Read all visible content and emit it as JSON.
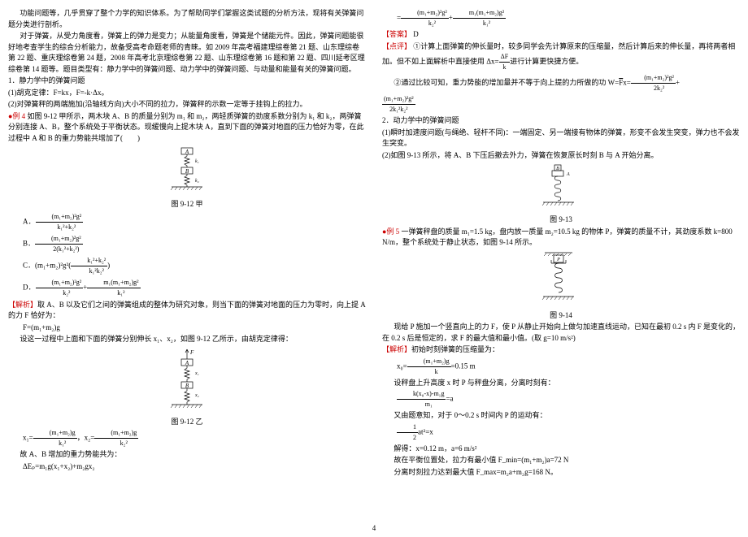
{
  "c1": {
    "p1": "功能问题等，几乎贯穿了整个力学的知识体系。为了帮助同学们掌握这类试题的分析方法，现将有关弹簧问题分类进行剖析。",
    "p2": "对于弹簧，从受力角度看，弹簧上的弹力是变力；从能量角度看，弹簧是个储能元件。因此，弹簧问题能很好地考查学生的综合分析能力，故备受高考命题老师的青睐。如 2009 年高考福建理综卷第 21 题、山东理综卷第 22 题、重庆理综卷第 24 题，2008 年高考北京理综卷第 22 题、山东理综卷第 16 题和第 22 题、四川延考区理综卷第 14 题等。题目类型有：静力学中的弹簧问题、动力学中的弹簧问题、与动量和能量有关的弹簧问题。",
    "s1": "1．静力学中的弹簧问题",
    "s1a": "(1)胡克定律：F=kx，F=-k·Δx。",
    "s1b": "(2)对弹簧秤的两端施加(沿轴线方向)大小不同的拉力，弹簧秤的示数一定等于挂钩上的拉力。",
    "ex4_lead": "●例 4",
    "ex4": "  如图 9-12 甲所示，两木块 A、B 的质量分别为 m₁ 和 m₂，两轻质弹簧的劲度系数分别为 k₁ 和 k₂，两弹簧分别连接 A、B，整个系统处于平衡状态。现缓慢向上提木块 A，直到下面的弹簧对地面的压力恰好为零，在此过程中 A 和 B 的重力势能共增加了(　　)",
    "cap1": "图 9-12 甲",
    "optA": "A．",
    "optB": "B．",
    "optC": "C．",
    "optD": "D．",
    "ans_h": "【解析】",
    "ans_t": "取 A、B 以及它们之间的弹簧组成的整体为研究对象，则当下面的弹簧对地面的压力为零时，向上提 A 的力 F 恰好为：",
    "f1": "F=(m₁+m₂)g",
    "ans_t2": "设这一过程中上面和下面的弹簧分别伸长 x₁、x₂，如图 9-12 乙所示，由胡克定律得：",
    "cap2": "图 9-12 乙",
    "f2x": "x₁=",
    "comma": "，",
    "f2y": "x₂=",
    "ep1": "故 A、B 增加的重力势能共为：",
    "ep2": "ΔEₚ=m₁g(x₁+x₂)+m₂gx₂"
  },
  "c2": {
    "f3_eq": "=",
    "f3_plus": "+",
    "ans_label": "【答案】",
    "ans": "  D",
    "note_h": "【点评】",
    "note": " ①计算上面弹簧的伸长量时，较多同学会先计算原来的压缩量，然后计算后来的伸长量，再将两者相加。但不如上面解析中直接使用 Δx=",
    "note2": "进行计算更快捷方便。",
    "note3": "②通过比较可知，重力势能的增加量并不等于向上提的力所做的功 W=",
    "note3b": "x=",
    "s2": "2．动力学中的弹簧问题",
    "s2a": "(1)瞬时加速度问题(与绳绝、轻杆不同)：一端固定、另一端接有物体的弹簧，形变不会发生突变，弹力也不会发生突变。",
    "s2b": "(2)如图 9-13 所示，将 A、B 下压后撤去外力，弹簧在恢复原长时刻 B 与 A 开始分离。",
    "cap3": "图 9-13",
    "ex5_lead": "●例 5",
    "ex5": "  一弹簧秤盘的质量 m₁=1.5 kg，盘内放一质量 m₂=10.5 kg 的物体 P，弹簧的质量不计，其劲度系数 k=800 N/m，整个系统处于静止状态，如图 9-14 所示。",
    "cap4": "图 9-14",
    "p_after": "现给 P 施加一个竖直向上的力 F，使 P 从静止开始向上做匀加速直线运动，已知在最初 0.2 s 内 F 是变化的，在 0.2 s 后是恒定的，求 F 的最大值和最小值。(取 g=10 m/s²)",
    "a_h": "【解析】",
    "a_t": "初始时刻弹簧的压缩量为：",
    "x0a": "x₀=",
    "x0b": "=0.15 m",
    "a2": "设秤盘上升高度 x 时 P 与秤盘分离，分离时刻有：",
    "eqk": "=a",
    "a3": "又由题意知，对于 0～0.2 s 时间内 P 的运动有：",
    "half": "at²=x",
    "a4": "解得：x=0.12 m，a=6 m/s²",
    "a5": "故在平衡位置处，拉力有最小值 F_min=(m₁+m₂)a=72 N",
    "a6": "分离时刻拉力达到最大值 F_max=m₂a+m₂g=168 N。"
  },
  "pagenum": "4"
}
